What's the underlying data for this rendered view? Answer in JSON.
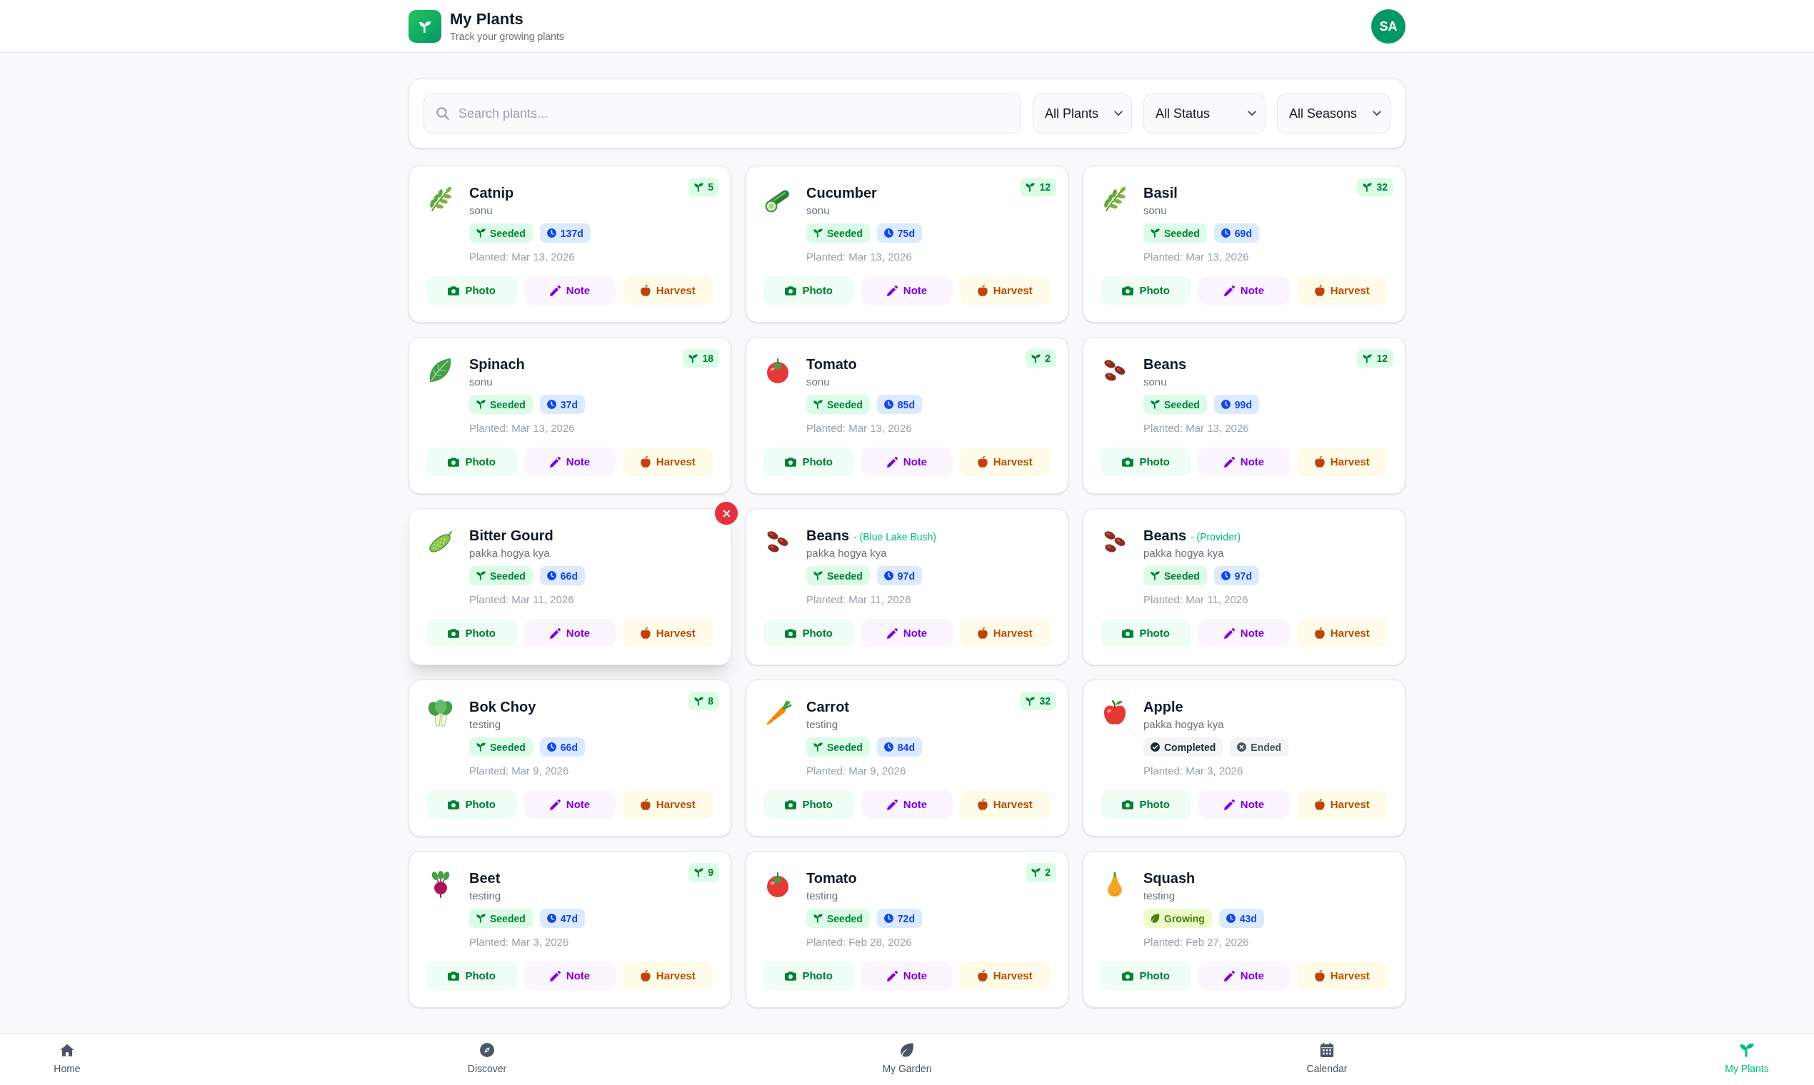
{
  "header": {
    "title": "My Plants",
    "subtitle": "Track your growing plants",
    "avatar": "SA"
  },
  "search": {
    "placeholder": "Search plants..."
  },
  "filters": [
    {
      "label": "All Plants"
    },
    {
      "label": "All Status"
    },
    {
      "label": "All Seasons"
    }
  ],
  "plants": [
    {
      "name": "Catnip",
      "owner": "sonu",
      "count": "5",
      "hovered": false,
      "badges": [
        {
          "kind": "seeded",
          "label": "Seeded"
        },
        {
          "kind": "days",
          "label": "137d"
        }
      ],
      "planted": "Planted: Mar 13, 2026",
      "actions": [
        {
          "kind": "photo",
          "label": "Photo"
        },
        {
          "kind": "note",
          "label": "Note"
        },
        {
          "kind": "harvest",
          "label": "Harvest"
        }
      ]
    },
    {
      "name": "Cucumber",
      "owner": "sonu",
      "count": "12",
      "hovered": false,
      "badges": [
        {
          "kind": "seeded",
          "label": "Seeded"
        },
        {
          "kind": "days",
          "label": "75d"
        }
      ],
      "planted": "Planted: Mar 13, 2026",
      "actions": [
        {
          "kind": "photo",
          "label": "Photo"
        },
        {
          "kind": "note",
          "label": "Note"
        },
        {
          "kind": "harvest",
          "label": "Harvest"
        }
      ]
    },
    {
      "name": "Basil",
      "owner": "sonu",
      "count": "32",
      "hovered": false,
      "badges": [
        {
          "kind": "seeded",
          "label": "Seeded"
        },
        {
          "kind": "days",
          "label": "69d"
        }
      ],
      "planted": "Planted: Mar 13, 2026",
      "actions": [
        {
          "kind": "photo",
          "label": "Photo"
        },
        {
          "kind": "note",
          "label": "Note"
        },
        {
          "kind": "harvest",
          "label": "Harvest"
        }
      ]
    },
    {
      "name": "Spinach",
      "owner": "sonu",
      "count": "18",
      "hovered": false,
      "badges": [
        {
          "kind": "seeded",
          "label": "Seeded"
        },
        {
          "kind": "days",
          "label": "37d"
        }
      ],
      "planted": "Planted: Mar 13, 2026",
      "actions": [
        {
          "kind": "photo",
          "label": "Photo"
        },
        {
          "kind": "note",
          "label": "Note"
        },
        {
          "kind": "harvest",
          "label": "Harvest"
        }
      ]
    },
    {
      "name": "Tomato",
      "owner": "sonu",
      "count": "2",
      "hovered": false,
      "badges": [
        {
          "kind": "seeded",
          "label": "Seeded"
        },
        {
          "kind": "days",
          "label": "85d"
        }
      ],
      "planted": "Planted: Mar 13, 2026",
      "actions": [
        {
          "kind": "photo",
          "label": "Photo"
        },
        {
          "kind": "note",
          "label": "Note"
        },
        {
          "kind": "harvest",
          "label": "Harvest"
        }
      ]
    },
    {
      "name": "Beans",
      "owner": "sonu",
      "count": "12",
      "hovered": false,
      "badges": [
        {
          "kind": "seeded",
          "label": "Seeded"
        },
        {
          "kind": "days",
          "label": "99d"
        }
      ],
      "planted": "Planted: Mar 13, 2026",
      "actions": [
        {
          "kind": "photo",
          "label": "Photo"
        },
        {
          "kind": "note",
          "label": "Note"
        },
        {
          "kind": "harvest",
          "label": "Harvest"
        }
      ]
    },
    {
      "name": "Bitter Gourd",
      "owner": "pakka hogya kya",
      "hovered": true,
      "badges": [
        {
          "kind": "seeded",
          "label": "Seeded"
        },
        {
          "kind": "days",
          "label": "66d"
        }
      ],
      "planted": "Planted: Mar 11, 2026",
      "actions": [
        {
          "kind": "photo",
          "label": "Photo"
        },
        {
          "kind": "note",
          "label": "Note"
        },
        {
          "kind": "harvest",
          "label": "Harvest"
        }
      ]
    },
    {
      "name": "Beans",
      "variety": "- (Blue Lake Bush)",
      "owner": "pakka hogya kya",
      "hovered": false,
      "badges": [
        {
          "kind": "seeded",
          "label": "Seeded"
        },
        {
          "kind": "days",
          "label": "97d"
        }
      ],
      "planted": "Planted: Mar 11, 2026",
      "actions": [
        {
          "kind": "photo",
          "label": "Photo"
        },
        {
          "kind": "note",
          "label": "Note"
        },
        {
          "kind": "harvest",
          "label": "Harvest"
        }
      ]
    },
    {
      "name": "Beans",
      "variety": "- (Provider)",
      "owner": "pakka hogya kya",
      "hovered": false,
      "badges": [
        {
          "kind": "seeded",
          "label": "Seeded"
        },
        {
          "kind": "days",
          "label": "97d"
        }
      ],
      "planted": "Planted: Mar 11, 2026",
      "actions": [
        {
          "kind": "photo",
          "label": "Photo"
        },
        {
          "kind": "note",
          "label": "Note"
        },
        {
          "kind": "harvest",
          "label": "Harvest"
        }
      ]
    },
    {
      "name": "Bok Choy",
      "owner": "testing",
      "count": "8",
      "hovered": false,
      "badges": [
        {
          "kind": "seeded",
          "label": "Seeded"
        },
        {
          "kind": "days",
          "label": "66d"
        }
      ],
      "planted": "Planted: Mar 9, 2026",
      "actions": [
        {
          "kind": "photo",
          "label": "Photo"
        },
        {
          "kind": "note",
          "label": "Note"
        },
        {
          "kind": "harvest",
          "label": "Harvest"
        }
      ]
    },
    {
      "name": "Carrot",
      "owner": "testing",
      "count": "32",
      "hovered": false,
      "badges": [
        {
          "kind": "seeded",
          "label": "Seeded"
        },
        {
          "kind": "days",
          "label": "84d"
        }
      ],
      "planted": "Planted: Mar 9, 2026",
      "actions": [
        {
          "kind": "photo",
          "label": "Photo"
        },
        {
          "kind": "note",
          "label": "Note"
        },
        {
          "kind": "harvest",
          "label": "Harvest"
        }
      ]
    },
    {
      "name": "Apple",
      "owner": "pakka hogya kya",
      "hovered": false,
      "badges": [
        {
          "kind": "completed",
          "label": "Completed"
        },
        {
          "kind": "ended",
          "label": "Ended"
        }
      ],
      "planted": "Planted: Mar 3, 2026",
      "actions": [
        {
          "kind": "photo",
          "label": "Photo"
        },
        {
          "kind": "note",
          "label": "Note"
        },
        {
          "kind": "harvest",
          "label": "Harvest"
        }
      ]
    },
    {
      "name": "Beet",
      "owner": "testing",
      "count": "9",
      "hovered": false,
      "badges": [
        {
          "kind": "seeded",
          "label": "Seeded"
        },
        {
          "kind": "days",
          "label": "47d"
        }
      ],
      "planted": "Planted: Mar 3, 2026",
      "actions": [
        {
          "kind": "photo",
          "label": "Photo"
        },
        {
          "kind": "note",
          "label": "Note"
        },
        {
          "kind": "harvest",
          "label": "Harvest"
        }
      ]
    },
    {
      "name": "Tomato",
      "owner": "testing",
      "count": "2",
      "hovered": false,
      "badges": [
        {
          "kind": "seeded",
          "label": "Seeded"
        },
        {
          "kind": "days",
          "label": "72d"
        }
      ],
      "planted": "Planted: Feb 28, 2026",
      "actions": [
        {
          "kind": "photo",
          "label": "Photo"
        },
        {
          "kind": "note",
          "label": "Note"
        },
        {
          "kind": "harvest",
          "label": "Harvest"
        }
      ]
    },
    {
      "name": "Squash",
      "owner": "testing",
      "hovered": false,
      "badges": [
        {
          "kind": "growing",
          "label": "Growing"
        },
        {
          "kind": "days",
          "label": "43d"
        }
      ],
      "planted": "Planted: Feb 27, 2026",
      "actions": [
        {
          "kind": "photo",
          "label": "Photo"
        },
        {
          "kind": "note",
          "label": "Note"
        },
        {
          "kind": "harvest",
          "label": "Harvest"
        }
      ]
    }
  ],
  "nav": [
    {
      "label": "Home",
      "selected": false
    },
    {
      "label": "Discover",
      "selected": false
    },
    {
      "label": "My Garden",
      "selected": false
    },
    {
      "label": "Calendar",
      "selected": false
    },
    {
      "label": "My Plants",
      "selected": true
    }
  ]
}
